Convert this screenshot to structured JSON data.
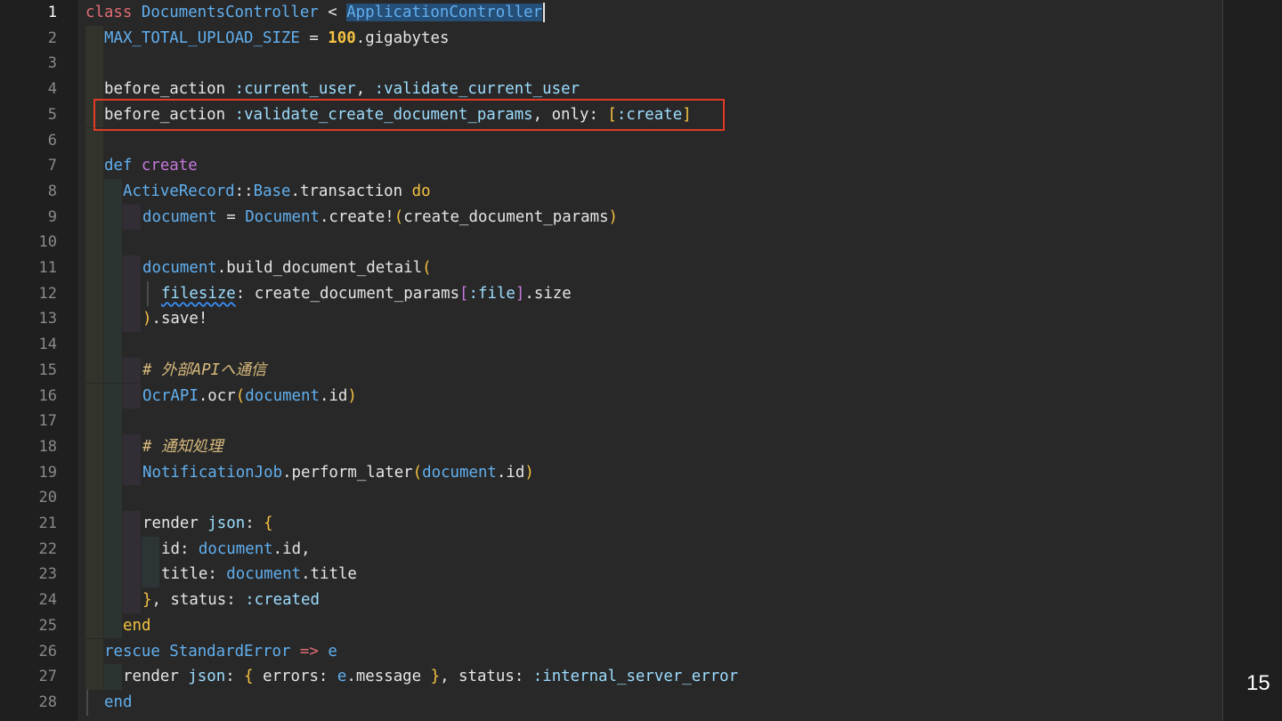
{
  "editor": {
    "language": "ruby",
    "active_line": 1,
    "highlighted_line": 5,
    "page_number": "15"
  },
  "line_numbers": [
    "1",
    "2",
    "3",
    "4",
    "5",
    "6",
    "7",
    "8",
    "9",
    "10",
    "11",
    "12",
    "13",
    "14",
    "15",
    "16",
    "17",
    "18",
    "19",
    "20",
    "21",
    "22",
    "23",
    "24",
    "25",
    "26",
    "27",
    "28"
  ],
  "code": {
    "l1": {
      "a": "class",
      "b": "DocumentsController",
      "c": " < ",
      "d": "ApplicationController"
    },
    "l2": {
      "a": "MAX_TOTAL_UPLOAD_SIZE",
      "b": " = ",
      "c": "100",
      "d": ".gigabytes"
    },
    "l4": {
      "a": "before_action",
      "b": " :current_user",
      "c": ", ",
      "d": ":validate_current_user"
    },
    "l5": {
      "a": "before_action",
      "b": " :validate_create_document_params",
      "c": ", only: ",
      "d": "[",
      "e": ":create",
      "f": "]"
    },
    "l7": {
      "a": "def",
      "b": " create"
    },
    "l8": {
      "a": "ActiveRecord",
      "b": "::",
      "c": "Base",
      "d": ".transaction ",
      "e": "do"
    },
    "l9": {
      "a": "document",
      "b": " = ",
      "c": "Document",
      "d": ".create!",
      "e": "(",
      "f": "create_document_params",
      "g": ")"
    },
    "l11": {
      "a": "document",
      "b": ".build_document_detail",
      "c": "("
    },
    "l12": {
      "a": "filesize",
      "b": ": create_document_params",
      "c": "[",
      "d": ":file",
      "e": "]",
      "f": ".size"
    },
    "l13": {
      "a": ")",
      "b": ".save!"
    },
    "l15": {
      "a": "# 外部APIへ通信"
    },
    "l16": {
      "a": "OcrAPI",
      "b": ".ocr",
      "c": "(",
      "d": "document",
      "e": ".id",
      "f": ")"
    },
    "l18": {
      "a": "# 通知処理"
    },
    "l19": {
      "a": "NotificationJob",
      "b": ".perform_later",
      "c": "(",
      "d": "document",
      "e": ".id",
      "f": ")"
    },
    "l21": {
      "a": "render ",
      "b": "json",
      "c": ": ",
      "d": "{"
    },
    "l22": {
      "a": "id: ",
      "b": "document",
      "c": ".id,"
    },
    "l23": {
      "a": "title: ",
      "b": "document",
      "c": ".title"
    },
    "l24": {
      "a": "}",
      "b": ", status: ",
      "c": ":created"
    },
    "l25": {
      "a": "end"
    },
    "l26": {
      "a": "rescue",
      "b": " StandardError",
      "c": " => ",
      "d": "e"
    },
    "l27": {
      "a": "render ",
      "b": "json",
      "c": ": ",
      "d": "{",
      "e": " errors: ",
      "f": "e",
      "g": ".message ",
      "h": "}",
      "i": ", status: ",
      "j": ":internal_server_error"
    },
    "l28": {
      "a": "end"
    }
  }
}
